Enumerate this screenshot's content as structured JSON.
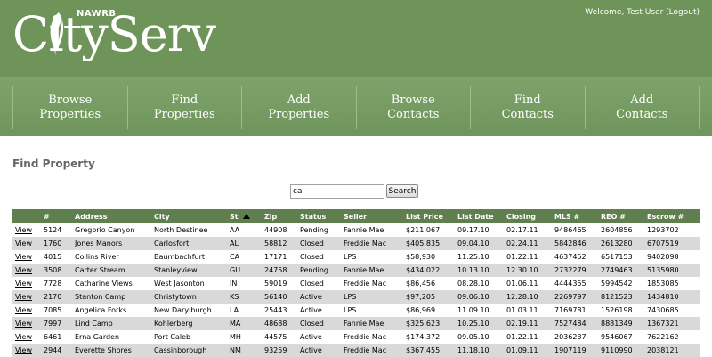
{
  "brand": {
    "name": "CityServ",
    "sub": "NAWRB"
  },
  "user": {
    "welcome": "Welcome,  Test User",
    "logout": "(Logout)"
  },
  "nav": [
    {
      "label": "Browse\nProperties"
    },
    {
      "label": "Find\nProperties"
    },
    {
      "label": "Add\nProperties"
    },
    {
      "label": "Browse\nContacts"
    },
    {
      "label": "Find\nContacts"
    },
    {
      "label": "Add\nContacts"
    }
  ],
  "page": {
    "title": "Find Property"
  },
  "search": {
    "value": "ca",
    "button": "Search"
  },
  "table": {
    "sort_column": "St",
    "columns": [
      "",
      "#",
      "Address",
      "City",
      "St",
      "Zip",
      "Status",
      "Seller",
      "List Price",
      "List Date",
      "Closing",
      "MLS #",
      "REO #",
      "Escrow #"
    ],
    "view_label": "View",
    "rows": [
      [
        "5124",
        "Gregorio Canyon",
        "North Destinee",
        "AA",
        "44908",
        "Pending",
        "Fannie Mae",
        "$211,067",
        "09.17.10",
        "02.17.11",
        "9486465",
        "2604856",
        "1293702"
      ],
      [
        "1760",
        "Jones Manors",
        "Carlosfort",
        "AL",
        "58812",
        "Closed",
        "Freddie Mac",
        "$405,835",
        "09.04.10",
        "02.24.11",
        "5842846",
        "2613280",
        "6707519"
      ],
      [
        "4015",
        "Collins River",
        "Baumbachfurt",
        "CA",
        "17171",
        "Closed",
        "LPS",
        "$58,930",
        "11.25.10",
        "01.22.11",
        "4637452",
        "6517153",
        "9402098"
      ],
      [
        "3508",
        "Carter Stream",
        "Stanleyview",
        "GU",
        "24758",
        "Pending",
        "Fannie Mae",
        "$434,022",
        "10.13.10",
        "12.30.10",
        "2732279",
        "2749463",
        "5135980"
      ],
      [
        "7728",
        "Catharine Views",
        "West Jasonton",
        "IN",
        "59019",
        "Closed",
        "Freddie Mac",
        "$86,456",
        "08.28.10",
        "01.06.11",
        "4444355",
        "5994542",
        "1853085"
      ],
      [
        "2170",
        "Stanton Camp",
        "Christytown",
        "KS",
        "56140",
        "Active",
        "LPS",
        "$97,205",
        "09.06.10",
        "12.28.10",
        "2269797",
        "8121523",
        "1434810"
      ],
      [
        "7085",
        "Angelica Forks",
        "New Darylburgh",
        "LA",
        "25443",
        "Active",
        "LPS",
        "$86,969",
        "11.09.10",
        "01.03.11",
        "7169781",
        "1526198",
        "7430685"
      ],
      [
        "7997",
        "Lind Camp",
        "Kohlerberg",
        "MA",
        "48688",
        "Closed",
        "Fannie Mae",
        "$325,623",
        "10.25.10",
        "02.19.11",
        "7527484",
        "8881349",
        "1367321"
      ],
      [
        "6461",
        "Erna Garden",
        "Port Caleb",
        "MH",
        "44575",
        "Active",
        "Freddie Mac",
        "$174,372",
        "09.05.10",
        "01.22.11",
        "2036237",
        "9546067",
        "7622162"
      ],
      [
        "2944",
        "Everette Shores",
        "Cassinborough",
        "NM",
        "93259",
        "Active",
        "Freddie Mac",
        "$367,455",
        "11.18.10",
        "01.09.11",
        "1907119",
        "9110990",
        "2038121"
      ]
    ]
  }
}
